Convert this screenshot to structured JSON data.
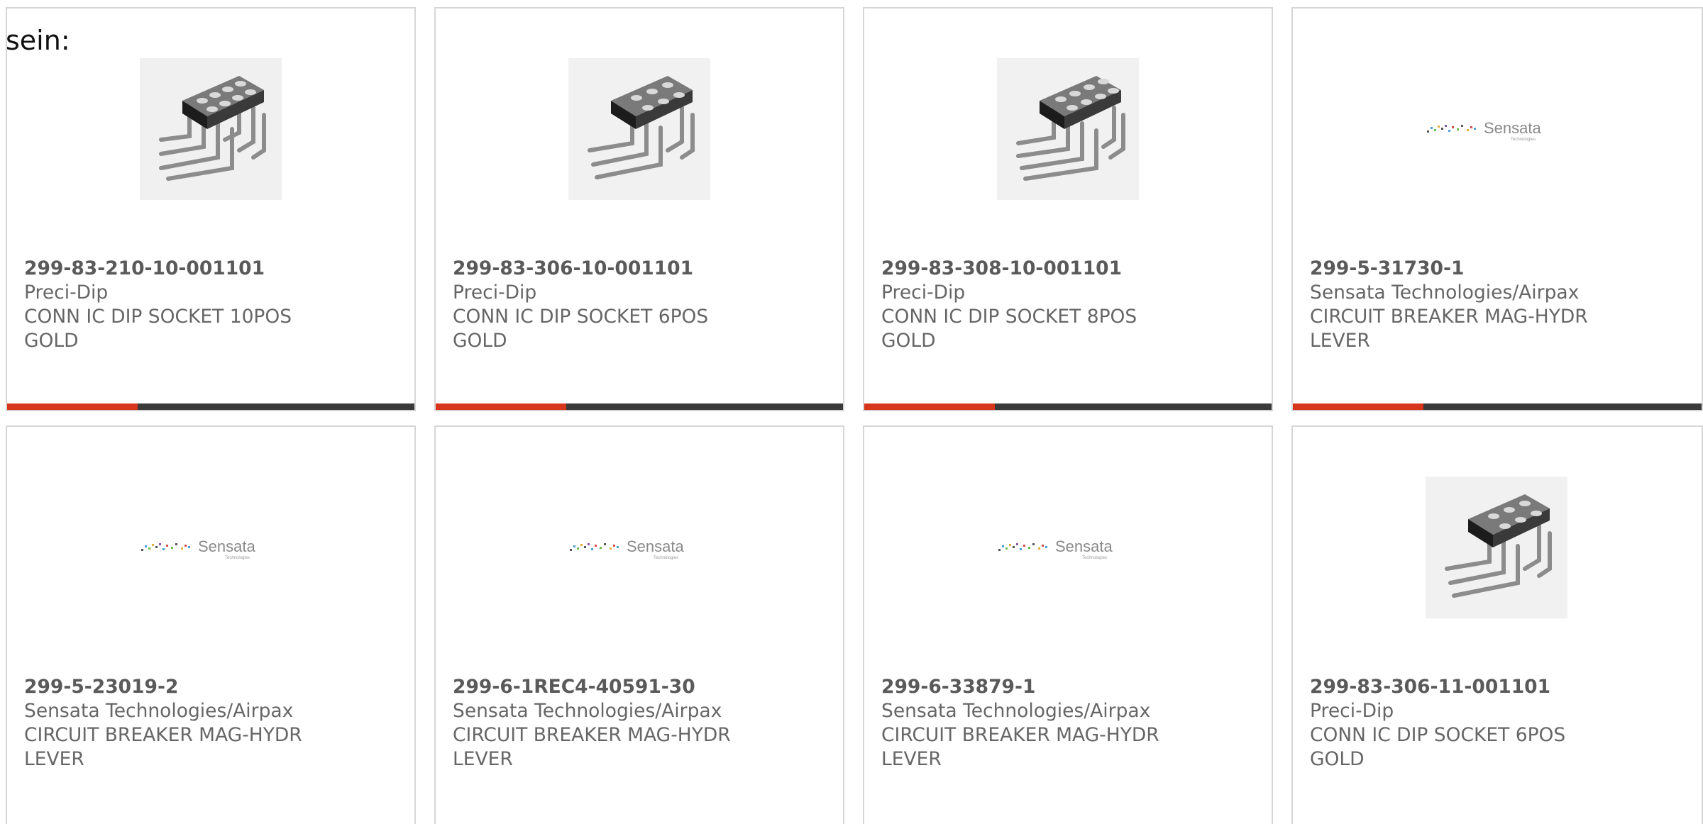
{
  "intro_text": "sein:",
  "colors": {
    "accent": "#d8361c",
    "bar": "#3a3a3a",
    "border": "#d6d6d6"
  },
  "logo_text": {
    "brand": "Sensata",
    "sub": "Technologies"
  },
  "cards": [
    {
      "part_number": "299-83-210-10-001101",
      "manufacturer": "Preci-Dip",
      "description": "CONN IC DIP SOCKET 10POS\nGOLD",
      "image": "dip-socket-icon",
      "progress": 0.32
    },
    {
      "part_number": "299-83-306-10-001101",
      "manufacturer": "Preci-Dip",
      "description": "CONN IC DIP SOCKET 6POS\nGOLD",
      "image": "dip-socket-icon",
      "progress": 0.32
    },
    {
      "part_number": "299-83-308-10-001101",
      "manufacturer": "Preci-Dip",
      "description": "CONN IC DIP SOCKET 8POS\nGOLD",
      "image": "dip-socket-icon",
      "progress": 0.32
    },
    {
      "part_number": "299-5-31730-1",
      "manufacturer": "Sensata Technologies/Airpax",
      "description": "CIRCUIT BREAKER MAG-HYDR\nLEVER",
      "image": "sensata-logo",
      "progress": 0.32
    },
    {
      "part_number": "299-5-23019-2",
      "manufacturer": "Sensata Technologies/Airpax",
      "description": "CIRCUIT BREAKER MAG-HYDR\nLEVER",
      "image": "sensata-logo"
    },
    {
      "part_number": "299-6-1REC4-40591-30",
      "manufacturer": "Sensata Technologies/Airpax",
      "description": "CIRCUIT BREAKER MAG-HYDR\nLEVER",
      "image": "sensata-logo"
    },
    {
      "part_number": "299-6-33879-1",
      "manufacturer": "Sensata Technologies/Airpax",
      "description": "CIRCUIT BREAKER MAG-HYDR\nLEVER",
      "image": "sensata-logo"
    },
    {
      "part_number": "299-83-306-11-001101",
      "manufacturer": "Preci-Dip",
      "description": "CONN IC DIP SOCKET 6POS\nGOLD",
      "image": "dip-socket-icon"
    }
  ]
}
